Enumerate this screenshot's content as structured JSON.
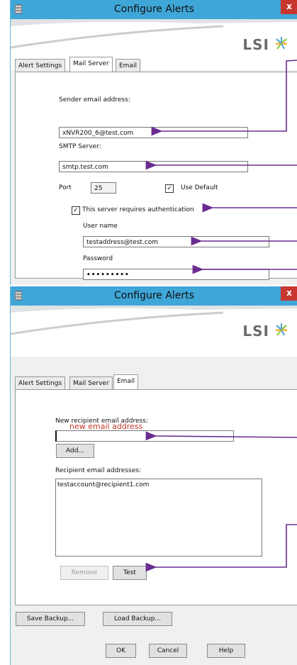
{
  "window1": {
    "title": "Configure Alerts",
    "logo": "LSI",
    "close": "x",
    "tabs": [
      "Alert Settings",
      "Mail Server",
      "Email"
    ],
    "sender_label": "Sender email address:",
    "sender_value": "xNVR200_6@test.com",
    "smtp_label": "SMTP Server:",
    "smtp_value": "smtp.test.com",
    "port_label": "Port",
    "port_value": "25",
    "use_default_label": "Use Default",
    "use_default_checked": true,
    "auth_label": "This server requires authentication",
    "auth_checked": true,
    "user_label": "User name",
    "user_value": "testaddress@test.com",
    "password_label": "Password",
    "password_value": "•••••••••"
  },
  "window2": {
    "title": "Configure Alerts",
    "logo": "LSI",
    "close": "x",
    "tabs": [
      "Alert Settings",
      "Mail Server",
      "Email"
    ],
    "new_recipient_label": "New recipient email address:",
    "new_recipient_value": "",
    "add_button": "Add...",
    "recipients_label": "Recipient email addresses:",
    "recipients": [
      "testaccount@recipient1.com"
    ],
    "remove_button": "Remove",
    "test_button": "Test",
    "save_backup": "Save Backup...",
    "load_backup": "Load Backup...",
    "ok": "OK",
    "cancel": "Cancel",
    "help": "Help"
  },
  "annotation": "new email address",
  "colors": {
    "titlebar": "#3fa6d8",
    "arrow": "#6a2c91",
    "annotation": "#c0392b",
    "close": "#c7372f"
  }
}
